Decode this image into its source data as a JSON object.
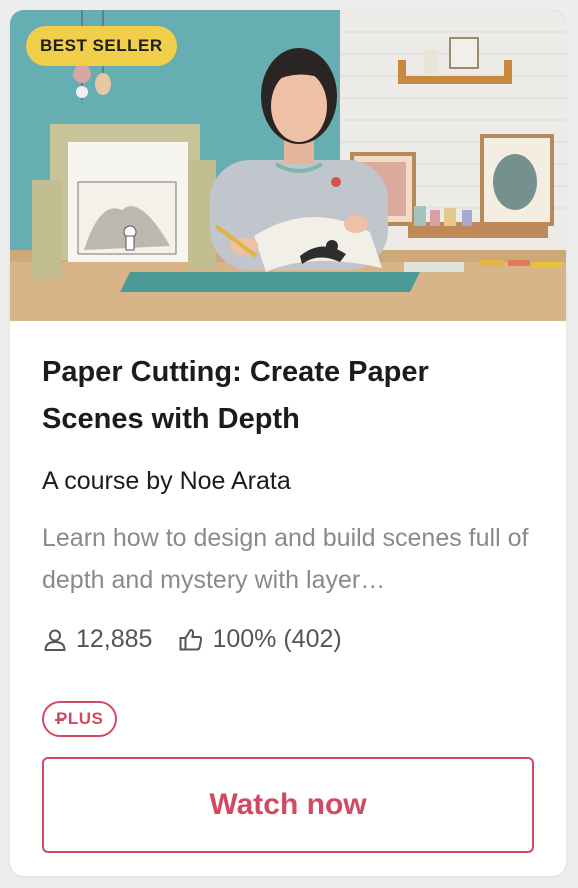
{
  "card": {
    "badge": "BEST SELLER",
    "title": "Paper Cutting: Create Paper Scenes with Depth",
    "author": "A course by Noe Arata",
    "description": "Learn how to design and build scenes full of depth and mystery with layer…",
    "students": "12,885",
    "rating": "100% (402)",
    "plan_badge": "PLUS",
    "cta": "Watch now"
  },
  "icons": {
    "students": "person-icon",
    "rating": "thumbs-up-icon"
  },
  "colors": {
    "badge_background": "#f2cf4a",
    "accent": "#d14a61",
    "title_text": "#1c1c1c",
    "description_text": "#8a8a8a"
  }
}
